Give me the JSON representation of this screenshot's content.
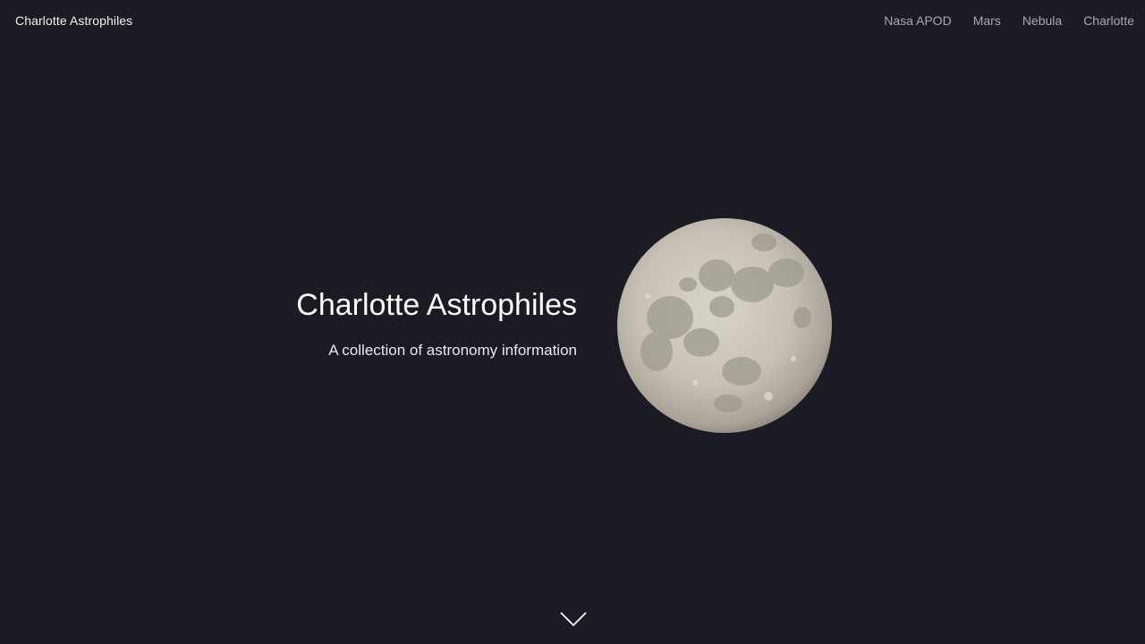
{
  "navbar": {
    "brand": "Charlotte Astrophiles",
    "links": [
      {
        "label": "Nasa APOD"
      },
      {
        "label": "Mars"
      },
      {
        "label": "Nebula"
      },
      {
        "label": "Charlotte"
      }
    ]
  },
  "hero": {
    "title": "Charlotte Astrophiles",
    "subtitle": "A collection of astronomy information",
    "image": "full-moon",
    "scroll_icon": "chevron-down-icon"
  },
  "colors": {
    "background": "#1b1b23",
    "text": "#ffffff",
    "nav_link": "#a9a9ae"
  }
}
